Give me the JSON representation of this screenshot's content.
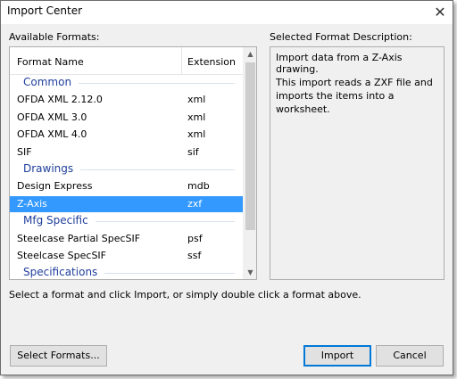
{
  "window": {
    "title": "Import Center",
    "close_glyph": "✕"
  },
  "available_formats": {
    "label": "Available Formats:",
    "columns": {
      "name": "Format Name",
      "extension": "Extension"
    },
    "rows": [
      {
        "kind": "group",
        "label": "Common"
      },
      {
        "kind": "item",
        "name": "OFDA XML 2.12.0",
        "ext": "xml"
      },
      {
        "kind": "item",
        "name": "OFDA XML 3.0",
        "ext": "xml"
      },
      {
        "kind": "item",
        "name": "OFDA XML 4.0",
        "ext": "xml"
      },
      {
        "kind": "item",
        "name": "SIF",
        "ext": "sif"
      },
      {
        "kind": "group",
        "label": "Drawings"
      },
      {
        "kind": "item",
        "name": "Design Express",
        "ext": "mdb"
      },
      {
        "kind": "item",
        "name": "Z-Axis",
        "ext": "zxf",
        "selected": true
      },
      {
        "kind": "group",
        "label": "Mfg Specific"
      },
      {
        "kind": "item",
        "name": "Steelcase Partial SpecSIF",
        "ext": "psf"
      },
      {
        "kind": "item",
        "name": "Steelcase SpecSIF",
        "ext": "ssf"
      },
      {
        "kind": "group",
        "label": "Specifications"
      }
    ]
  },
  "description": {
    "label": "Selected Format Description:",
    "line1": "Import data from a Z-Axis drawing.",
    "line2": "This import reads a ZXF file and imports the items into a worksheet."
  },
  "hint": "Select a format and click Import, or simply double click a format above.",
  "buttons": {
    "select_formats": "Select Formats...",
    "import": "Import",
    "cancel": "Cancel"
  },
  "scrollbar": {
    "up_glyph": "▲",
    "down_glyph": "▼"
  }
}
